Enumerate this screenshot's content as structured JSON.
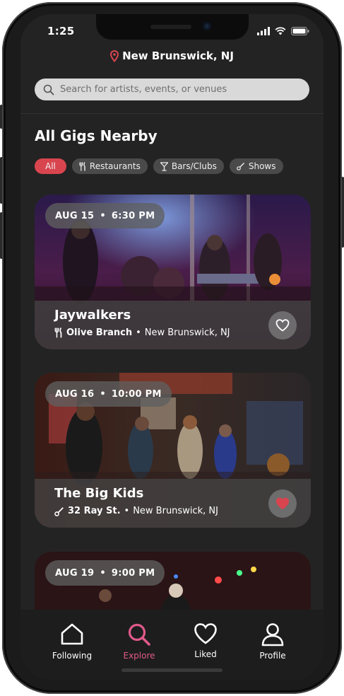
{
  "status": {
    "time": "1:25"
  },
  "location": {
    "label": "New Brunswick, NJ",
    "icon": "location-pin-icon"
  },
  "search": {
    "placeholder": "Search for artists, events, or venues",
    "value": ""
  },
  "section": {
    "title": "All Gigs Nearby"
  },
  "filters": [
    {
      "label": "All",
      "icon": "",
      "active": true
    },
    {
      "label": "Restaurants",
      "icon": "fork-knife-icon",
      "active": false
    },
    {
      "label": "Bars/Clubs",
      "icon": "cocktail-icon",
      "active": false
    },
    {
      "label": "Shows",
      "icon": "guitar-icon",
      "active": false
    }
  ],
  "gigs": [
    {
      "date": "AUG 15",
      "time": "6:30 PM",
      "name": "Jaywalkers",
      "venue": "Olive Branch",
      "city": "New Brunswick, NJ",
      "venue_icon": "fork-knife-icon",
      "liked": false
    },
    {
      "date": "AUG 16",
      "time": "10:00 PM",
      "name": "The Big Kids",
      "venue": "32 Ray St.",
      "city": "New Brunswick, NJ",
      "venue_icon": "guitar-icon",
      "liked": true
    },
    {
      "date": "AUG 19",
      "time": "9:00 PM"
    }
  ],
  "tabs": [
    {
      "label": "Following",
      "icon": "home-icon"
    },
    {
      "label": "Explore",
      "icon": "search-icon",
      "active": true
    },
    {
      "label": "Liked",
      "icon": "heart-icon"
    },
    {
      "label": "Profile",
      "icon": "person-icon"
    }
  ],
  "colors": {
    "accent": "#d9454f",
    "tab_active": "#e05a8a",
    "background": "#232323"
  }
}
